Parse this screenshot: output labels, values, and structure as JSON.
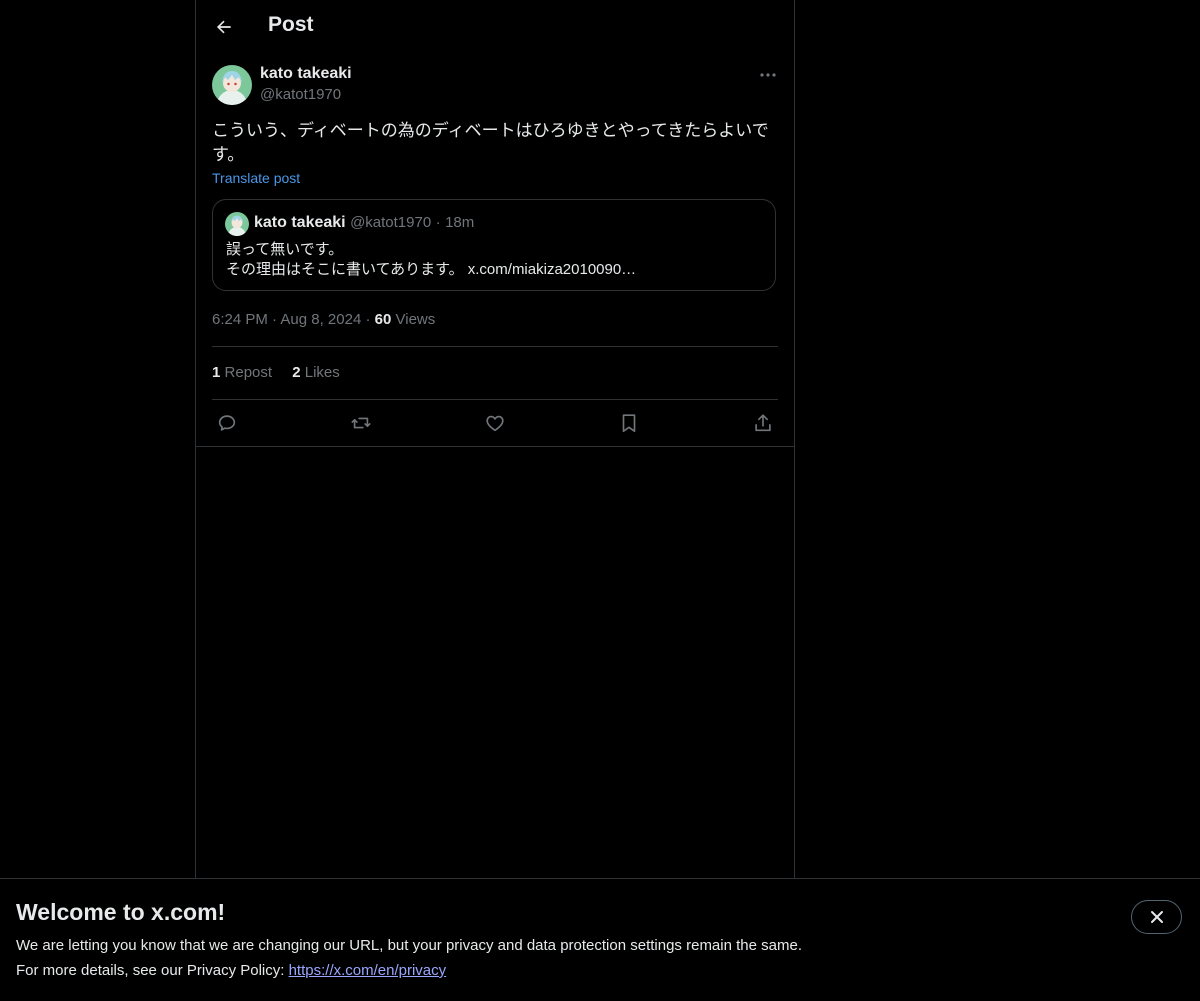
{
  "header": {
    "title": "Post"
  },
  "tweet": {
    "author_name": "kato takeaki",
    "author_handle": "@katot1970",
    "text": "こういう、ディベートの為のディベートはひろゆきとやってきたらよいです。",
    "translate_label": "Translate post",
    "time": "6:24 PM",
    "date": "Aug 8, 2024",
    "views_count": "60",
    "views_label": "Views",
    "separator": "·"
  },
  "quote": {
    "author_name": "kato takeaki",
    "author_handle": "@katot1970",
    "time_ago": "18m",
    "line1": "誤って無いです。",
    "line2": "その理由はそこに書いてあります。 x.com/miakiza2010090…"
  },
  "stats": {
    "reposts_count": "1",
    "reposts_label": "Repost",
    "likes_count": "2",
    "likes_label": "Likes"
  },
  "actions": [
    "reply-icon",
    "repost-icon",
    "like-icon",
    "bookmark-icon",
    "share-icon"
  ],
  "banner": {
    "title": "Welcome to x.com!",
    "line1": "We are letting you know that we are changing our URL, but your privacy and data protection settings remain the same.",
    "line2_prefix": "For more details, see our Privacy Policy: ",
    "link": "https://x.com/en/privacy"
  },
  "colors": {
    "background": "#000000",
    "text": "#e7e9ea",
    "muted": "#71767b",
    "border": "#2f3336",
    "link": "#4a97e8"
  }
}
